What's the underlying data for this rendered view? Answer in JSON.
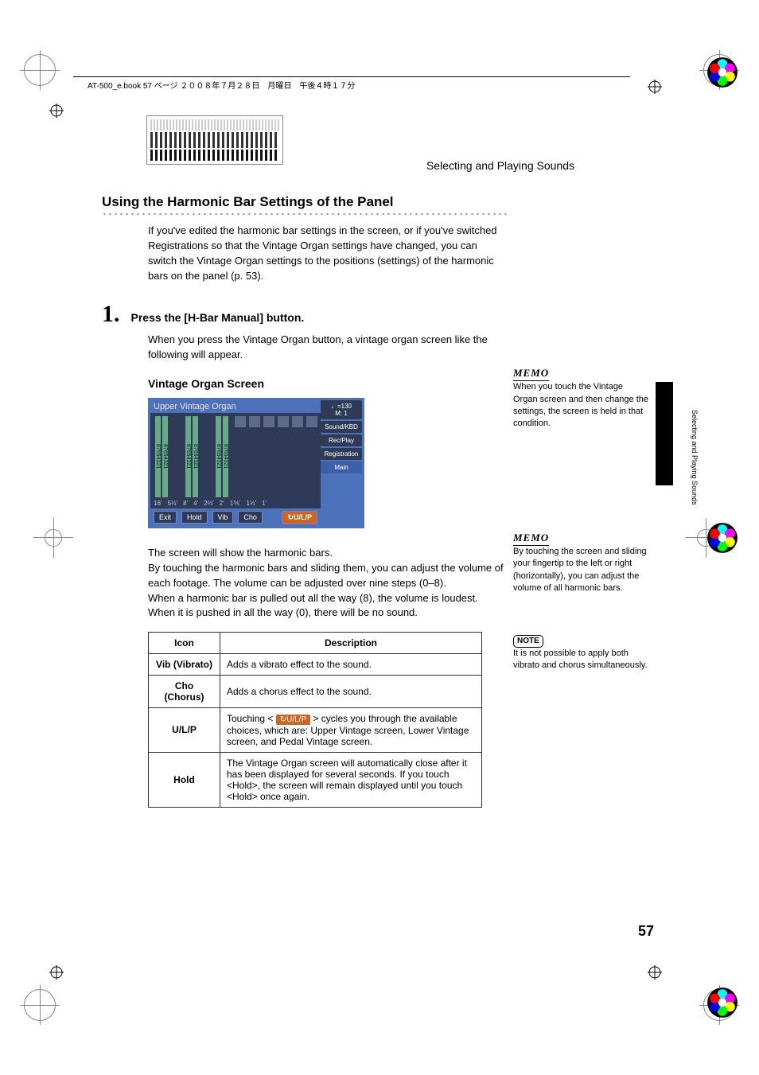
{
  "header": {
    "book_title": "AT-500_e.book  57 ページ  ２００８年７月２８日　月曜日　午後４時１７分"
  },
  "breadcrumb": "Selecting and Playing Sounds",
  "side_tab_label": "Selecting and Playing Sounds",
  "section_title": "Using the Harmonic Bar Settings of the Panel",
  "intro_text": "If you've edited the harmonic bar settings in the screen, or if you've switched Registrations so that the Vintage Organ settings have changed, you can switch the Vintage Organ settings to the positions (settings) of the harmonic bars on the panel (p. 53).",
  "step1": {
    "number": "1.",
    "label": "Press the [H-Bar Manual] button.",
    "body": "When you press the Vintage Organ button, a vintage organ screen like the following will appear."
  },
  "vorgan_subhead": "Vintage Organ Screen",
  "vorgan": {
    "title_left": "Upper Vintage Organ",
    "tempo": "♩=130",
    "measure": "M:    1",
    "right_buttons": [
      "Sound/KBD",
      "Rec/Play",
      "Registration",
      "Main"
    ],
    "bottom_buttons": [
      "Exit",
      "Hold",
      "Vib",
      "Cho",
      "U/L/P"
    ],
    "footages": [
      "16'",
      "5⅓'",
      "8'",
      "4'",
      "2⅔'",
      "2'",
      "1⅗'",
      "1⅓'",
      "1'"
    ],
    "bar_numbers": "87654321"
  },
  "post_screen": {
    "l1": "The screen will show the harmonic bars.",
    "l2": "By touching the harmonic bars and sliding them, you can adjust the volume of each footage. The volume can be adjusted over nine steps (0–8).",
    "l3": "When a harmonic bar is pulled out all the way (8), the volume is loudest. When it is pushed in all the way (0), there will be no sound."
  },
  "table": {
    "head_icon": "Icon",
    "head_desc": "Description",
    "rows": [
      {
        "icon": "Vib (Vibrato)",
        "desc": "Adds a vibrato effect to the sound."
      },
      {
        "icon": "Cho (Chorus)",
        "desc": "Adds a chorus effect to the sound."
      },
      {
        "icon": "U/L/P",
        "desc_pre": "Touching < ",
        "chip": "U/L/P",
        "desc_post": " > cycles you through the available choices, which are: Upper Vintage screen, Lower Vintage screen, and Pedal Vintage screen."
      },
      {
        "icon": "Hold",
        "desc": "The Vintage Organ screen will automatically close after it has been displayed for several seconds. If you touch <Hold>, the screen will remain displayed until you touch <Hold> once again."
      }
    ]
  },
  "memos": {
    "m1_label": "MEMO",
    "m1_text": "When you touch the Vintage Organ screen and then change the settings, the screen is held in that condition.",
    "m2_label": "MEMO",
    "m2_text": "By touching the screen and sliding your fingertip to the left or right (horizontally), you can adjust the volume of all harmonic bars.",
    "note_label": "NOTE",
    "note_text": "It is not possible to apply both vibrato and chorus simultaneously."
  },
  "page_number": "57"
}
